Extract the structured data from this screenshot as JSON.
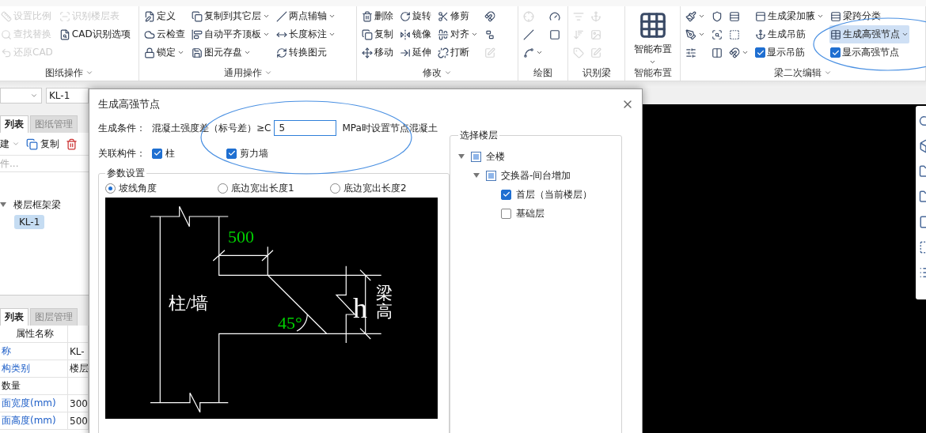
{
  "ribbon": {
    "groups": [
      {
        "label": "图纸操作",
        "caret": true,
        "columns": [
          [
            {
              "kind": "button",
              "label": "设置比例",
              "disabled": true,
              "selected": false
            },
            {
              "kind": "button",
              "label": "查找替换",
              "disabled": true,
              "selected": false
            },
            {
              "kind": "button",
              "label": "还原CAD",
              "disabled": true,
              "selected": false
            }
          ],
          [
            {
              "kind": "button",
              "label": "识别楼层表",
              "disabled": true,
              "selected": false
            },
            {
              "kind": "button",
              "label": "CAD识别选项",
              "disabled": false,
              "selected": false
            }
          ]
        ]
      },
      {
        "label": "通用操作",
        "caret": true,
        "columns": [
          [
            {
              "kind": "button",
              "label": "定义",
              "disabled": false,
              "selected": false
            },
            {
              "kind": "button",
              "label": "云检查",
              "disabled": false,
              "selected": false
            },
            {
              "kind": "button",
              "label": "锁定",
              "caret": true,
              "disabled": false,
              "selected": false
            }
          ],
          [
            {
              "kind": "button",
              "label": "复制到其它层",
              "caret": true,
              "disabled": false,
              "selected": false
            },
            {
              "kind": "button",
              "label": "自动平齐顶板",
              "caret": true,
              "disabled": false,
              "selected": false
            },
            {
              "kind": "button",
              "label": "图元存盘",
              "caret": true,
              "disabled": false,
              "selected": false
            }
          ],
          [
            {
              "kind": "button",
              "label": "两点辅轴",
              "caret": true,
              "disabled": false,
              "selected": false
            },
            {
              "kind": "button",
              "label": "长度标注",
              "caret": true,
              "disabled": false,
              "selected": false
            },
            {
              "kind": "button",
              "label": "转换图元",
              "disabled": false,
              "selected": false
            }
          ]
        ]
      },
      {
        "label": "修改",
        "caret": true,
        "columns": [
          [
            {
              "kind": "button",
              "label": "删除",
              "disabled": false,
              "selected": false
            },
            {
              "kind": "button",
              "label": "复制",
              "disabled": false,
              "selected": false
            },
            {
              "kind": "button",
              "label": "移动",
              "disabled": false,
              "selected": false
            }
          ],
          [
            {
              "kind": "button",
              "label": "旋转",
              "disabled": false,
              "selected": false
            },
            {
              "kind": "button",
              "label": "镜像",
              "disabled": false,
              "selected": false
            },
            {
              "kind": "button",
              "label": "延伸",
              "disabled": false,
              "selected": false
            }
          ],
          [
            {
              "kind": "button",
              "label": "修剪",
              "disabled": false,
              "selected": false
            },
            {
              "kind": "button",
              "label": "对齐",
              "caret": true,
              "disabled": false,
              "selected": false
            },
            {
              "kind": "button",
              "label": "打断",
              "disabled": false,
              "selected": false
            }
          ],
          [
            {
              "kind": "icon",
              "disabled": false,
              "selected": false
            },
            {
              "kind": "icon",
              "disabled": false,
              "selected": false
            },
            {
              "kind": "icon",
              "disabled": true,
              "selected": false
            }
          ]
        ]
      },
      {
        "label": "绘图",
        "caret": false,
        "columns": [
          [
            {
              "kind": "icon",
              "disabled": true,
              "selected": false
            },
            {
              "kind": "icon",
              "disabled": false,
              "selected": false
            },
            {
              "kind": "icon",
              "caret": true,
              "disabled": false,
              "selected": false
            }
          ],
          [
            {
              "kind": "icon",
              "disabled": false,
              "selected": false
            },
            {
              "kind": "icon",
              "disabled": false,
              "selected": false
            }
          ]
        ]
      },
      {
        "label": "识别梁",
        "caret": false,
        "columns": [
          [
            {
              "kind": "icon",
              "disabled": true,
              "selected": false
            },
            {
              "kind": "icon",
              "disabled": true,
              "selected": false
            },
            {
              "kind": "icon",
              "disabled": true,
              "selected": false
            }
          ],
          [
            {
              "kind": "icon",
              "disabled": true,
              "selected": false
            },
            {
              "kind": "icon",
              "disabled": true,
              "selected": false
            },
            {
              "kind": "icon",
              "disabled": true,
              "selected": false
            }
          ]
        ]
      },
      {
        "label": "智能布置",
        "caret": false,
        "columns": [
          [
            {
              "kind": "large",
              "label": "智能布置",
              "caret": true,
              "disabled": false,
              "selected": false
            }
          ]
        ]
      },
      {
        "label": "梁二次编辑",
        "caret": true,
        "columns": [
          [
            {
              "kind": "icon",
              "caret": true,
              "disabled": false,
              "selected": false
            },
            {
              "kind": "icon",
              "caret": true,
              "disabled": false,
              "selected": false
            },
            {
              "kind": "icon",
              "disabled": false,
              "selected": false
            }
          ],
          [
            {
              "kind": "icon",
              "disabled": false,
              "selected": false
            },
            {
              "kind": "icon",
              "disabled": false,
              "selected": false
            },
            {
              "kind": "icon",
              "disabled": false,
              "selected": false
            }
          ],
          [
            {
              "kind": "icon",
              "disabled": false,
              "selected": false
            },
            {
              "kind": "icon",
              "disabled": false,
              "selected": false
            },
            {
              "kind": "icon",
              "caret": true,
              "disabled": false,
              "selected": false
            }
          ],
          [
            {
              "kind": "button",
              "label": "生成梁加腋",
              "caret": true,
              "disabled": false,
              "selected": false
            },
            {
              "kind": "button",
              "label": "生成吊筋",
              "disabled": false,
              "selected": false
            },
            {
              "kind": "checkbox",
              "label": "显示吊筋",
              "checked": true,
              "disabled": false,
              "selected": false
            }
          ],
          [
            {
              "kind": "button",
              "label": "梁跨分类",
              "disabled": false,
              "selected": false
            },
            {
              "kind": "button",
              "label": "生成高强节点",
              "caret": true,
              "disabled": false,
              "selected": true
            },
            {
              "kind": "checkbox",
              "label": "显示高强节点",
              "checked": true,
              "disabled": false,
              "selected": false
            }
          ]
        ]
      }
    ]
  },
  "left_panel": {
    "selector": {
      "value": "KL-1"
    },
    "tabs": [
      {
        "label": "列表",
        "selected": true
      },
      {
        "label": "图纸管理",
        "selected": false
      }
    ],
    "toolbar": [
      {
        "kind": "new",
        "label": "建"
      },
      {
        "kind": "copy",
        "label": "复制"
      },
      {
        "kind": "delete"
      }
    ],
    "search": {
      "placeholder": "件..."
    },
    "tree": [
      {
        "label": "楼层框架梁",
        "expanded": true,
        "selected": false,
        "children": [
          {
            "label": "KL-1",
            "selected": true
          }
        ]
      }
    ],
    "property_tabs": [
      {
        "label": "列表",
        "selected": true
      },
      {
        "label": "图层管理",
        "selected": false
      }
    ],
    "properties": {
      "header": "属性名称",
      "rows": [
        {
          "name": "称",
          "value": "KL-",
          "public": true
        },
        {
          "name": "构类别",
          "value": "楼层",
          "public": true
        },
        {
          "name": "数量",
          "value": "",
          "public": false
        },
        {
          "name": "面宽度(mm)",
          "value": "300",
          "public": true
        },
        {
          "name": "面高度(mm)",
          "value": "500",
          "public": true
        }
      ]
    }
  },
  "dialog": {
    "title": "生成高强节点",
    "condition": {
      "label": "生成条件：",
      "text": "混凝土强度差（标号差）≥C",
      "value": "5",
      "suffix": "MPa时设置节点混凝土"
    },
    "related": {
      "label": "关联构件：",
      "options": [
        {
          "label": "柱",
          "checked": true
        },
        {
          "label": "剪力墙",
          "checked": true
        }
      ]
    },
    "params": {
      "legend": "参数设置",
      "options": [
        {
          "label": "坡线角度",
          "selected": true
        },
        {
          "label": "底边宽出长度1",
          "selected": false
        },
        {
          "label": "底边宽出长度2",
          "selected": false
        }
      ],
      "diagram": {
        "width_label": "500",
        "angle_label": "45°",
        "wall_label": "柱/墙",
        "height_symbol": "h",
        "height_label": "梁高"
      }
    },
    "floors": {
      "legend": "选择楼层",
      "tree": [
        {
          "label": "全楼",
          "checked": false,
          "partial": true,
          "expanded": true,
          "children": [
            {
              "label": "交换器-间台增加",
              "checked": false,
              "partial": true,
              "expanded": true,
              "children": [
                {
                  "label": "首层（当前楼层）",
                  "checked": true
                },
                {
                  "label": "基础层",
                  "checked": false
                }
              ]
            }
          ]
        }
      ]
    }
  }
}
